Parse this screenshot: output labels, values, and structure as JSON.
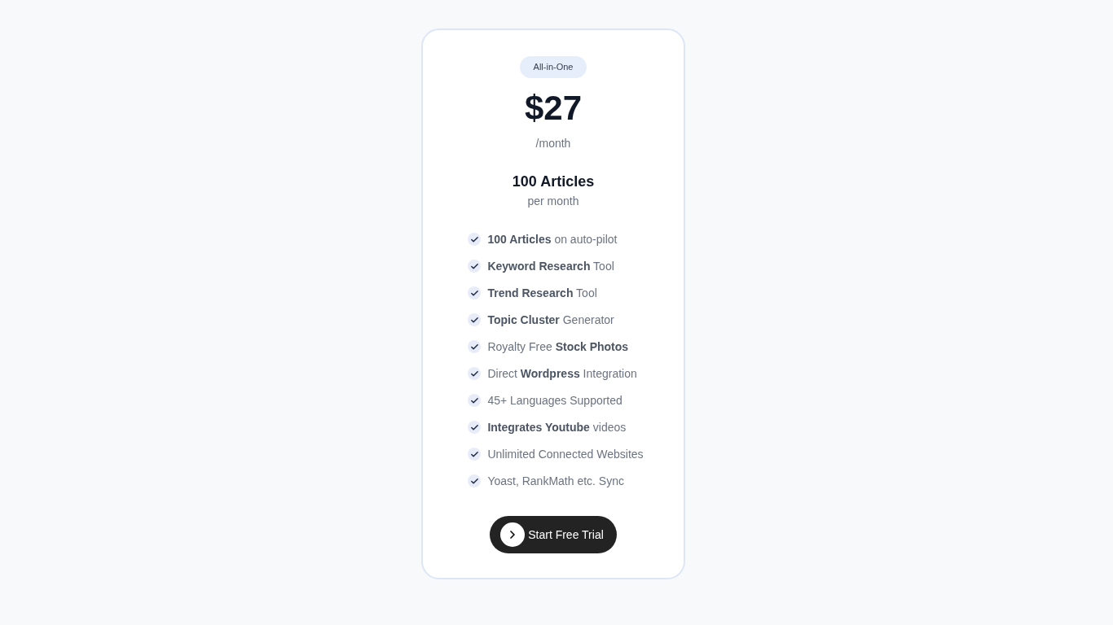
{
  "plan": {
    "badge": "All-in-One",
    "price": "$27",
    "period": "/month",
    "quota": "100 Articles",
    "quota_period": "per month"
  },
  "features": [
    {
      "text": "**100 Articles** on auto-pilot"
    },
    {
      "text": "**Keyword Research** Tool"
    },
    {
      "text": "**Trend Research** Tool"
    },
    {
      "text": "**Topic Cluster** Generator"
    },
    {
      "text": "Royalty Free **Stock Photos**"
    },
    {
      "text": "Direct **Wordpress** Integration"
    },
    {
      "text": "45+ Languages Supported"
    },
    {
      "text": "**Integrates Youtube** videos"
    },
    {
      "text": "Unlimited Connected Websites"
    },
    {
      "text": "Yoast, RankMath etc. Sync"
    }
  ],
  "cta": {
    "label": "Start Free Trial"
  }
}
